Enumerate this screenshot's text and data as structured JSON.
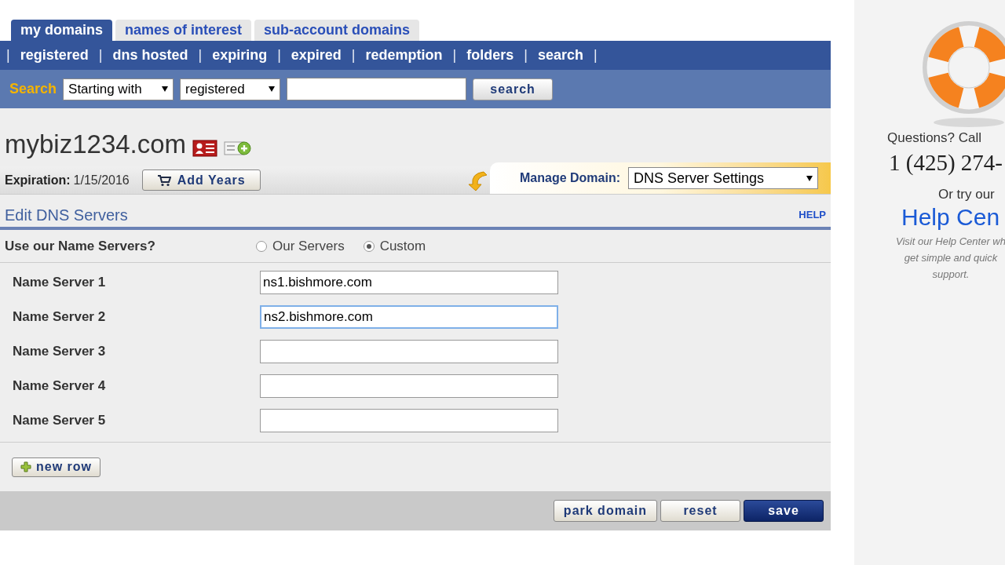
{
  "tabs": [
    {
      "label": "my domains",
      "selected": true
    },
    {
      "label": "names of interest",
      "selected": false
    },
    {
      "label": "sub-account domains",
      "selected": false
    }
  ],
  "nav": [
    {
      "kind": "separator",
      "text": "|"
    },
    {
      "kind": "link",
      "text": "registered"
    },
    {
      "kind": "separator",
      "text": "|"
    },
    {
      "kind": "link",
      "text": "dns hosted"
    },
    {
      "kind": "separator",
      "text": "|"
    },
    {
      "kind": "link",
      "text": "expiring"
    },
    {
      "kind": "separator",
      "text": "|"
    },
    {
      "kind": "link",
      "text": "expired"
    },
    {
      "kind": "separator",
      "text": "|"
    },
    {
      "kind": "link",
      "text": "redemption"
    },
    {
      "kind": "separator",
      "text": "|"
    },
    {
      "kind": "link",
      "text": "folders"
    },
    {
      "kind": "separator",
      "text": "|"
    },
    {
      "kind": "link",
      "text": "search"
    },
    {
      "kind": "separator",
      "text": "|"
    }
  ],
  "search": {
    "label": "Search",
    "mode": "Starting with",
    "scope": "registered",
    "button": "search"
  },
  "domain": {
    "name": "mybiz1234.com"
  },
  "expiration": {
    "label": "Expiration:",
    "date": "1/15/2016",
    "button": "Add Years"
  },
  "manage": {
    "label": "Manage Domain:",
    "value": "DNS Server Settings"
  },
  "section": {
    "title": "Edit DNS Servers",
    "help": "HELP"
  },
  "use_ns": {
    "label": "Use our Name Servers?",
    "options": [
      {
        "label": "Our Servers",
        "selected": false
      },
      {
        "label": "Custom",
        "selected": true
      }
    ]
  },
  "name_servers": [
    {
      "label": "Name Server 1",
      "value": "ns1.bishmore.com",
      "focused": false
    },
    {
      "label": "Name Server 2",
      "value": "ns2.bishmore.com",
      "focused": true
    },
    {
      "label": "Name Server 3",
      "focused": false
    },
    {
      "label": "Name Server 4",
      "focused": false
    },
    {
      "label": "Name Server 5",
      "focused": false
    }
  ],
  "new_row": "new row",
  "actions": [
    {
      "label": "park domain",
      "kind": "secondary"
    },
    {
      "label": "reset",
      "kind": "secondary"
    },
    {
      "label": "save",
      "kind": "primary"
    }
  ],
  "support": {
    "question": "Questions? Call",
    "phone": "1 (425) 274-",
    "alt": "Or try our",
    "link": "Help Cen",
    "note": [
      "Visit our Help Center wh",
      "get simple and quick",
      "support."
    ]
  }
}
